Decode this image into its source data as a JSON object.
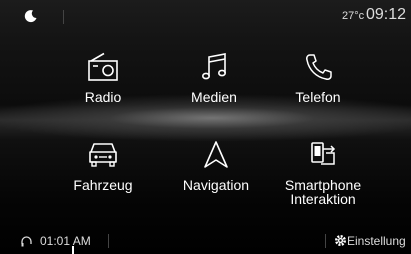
{
  "status": {
    "temperature": "27°c",
    "clock": "09:12"
  },
  "tiles": [
    {
      "label": "Radio",
      "icon": "radio-icon"
    },
    {
      "label": "Medien",
      "icon": "music-note-icon"
    },
    {
      "label": "Telefon",
      "icon": "phone-icon"
    },
    {
      "label": "Fahrzeug",
      "icon": "car-icon"
    },
    {
      "label": "Navigation",
      "icon": "navigation-arrow-icon"
    },
    {
      "label": "Smartphone\nInteraktion",
      "icon": "smartphone-mirror-icon"
    }
  ],
  "bottom": {
    "time": "01:01 AM",
    "settings_label": "Einstellung"
  },
  "colors": {
    "background": "#000000",
    "text": "#ffffff",
    "separator": "#444444"
  }
}
